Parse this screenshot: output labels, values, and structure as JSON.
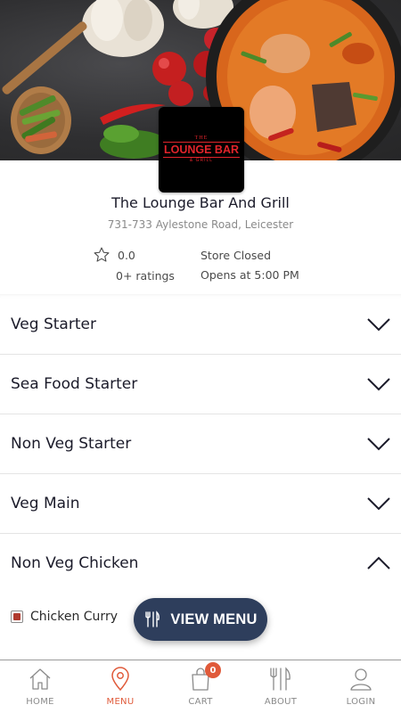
{
  "restaurant": {
    "logo": {
      "line1": "THE",
      "line2": "LOUNGE BAR",
      "line3": "& GRILL"
    },
    "name": "The Lounge Bar And Grill",
    "address": "731-733 Aylestone Road, Leicester",
    "rating": "0.0",
    "rating_count": "0+ ratings",
    "status": "Store Closed",
    "hours": "Opens at 5:00 PM"
  },
  "menu": {
    "categories": [
      {
        "label": "Veg Starter",
        "expanded": false
      },
      {
        "label": "Sea Food Starter",
        "expanded": false
      },
      {
        "label": "Non Veg Starter",
        "expanded": false
      },
      {
        "label": "Veg Main",
        "expanded": false
      },
      {
        "label": "Non Veg Chicken",
        "expanded": true
      }
    ],
    "sub_items": [
      {
        "label": "Chicken Curry",
        "checked": true
      }
    ],
    "view_menu_label": "VIEW MENU"
  },
  "nav": {
    "items": [
      {
        "label": "HOME",
        "icon": "home-icon",
        "active": false
      },
      {
        "label": "MENU",
        "icon": "location-pin-icon",
        "active": true
      },
      {
        "label": "CART",
        "icon": "shopping-bag-icon",
        "active": false,
        "badge": "0"
      },
      {
        "label": "ABOUT",
        "icon": "cutlery-icon",
        "active": false
      },
      {
        "label": "LOGIN",
        "icon": "user-icon",
        "active": false
      }
    ]
  },
  "colors": {
    "accent": "#e05a3a",
    "button": "#2e3e5c",
    "brand_red": "#e3242b"
  }
}
